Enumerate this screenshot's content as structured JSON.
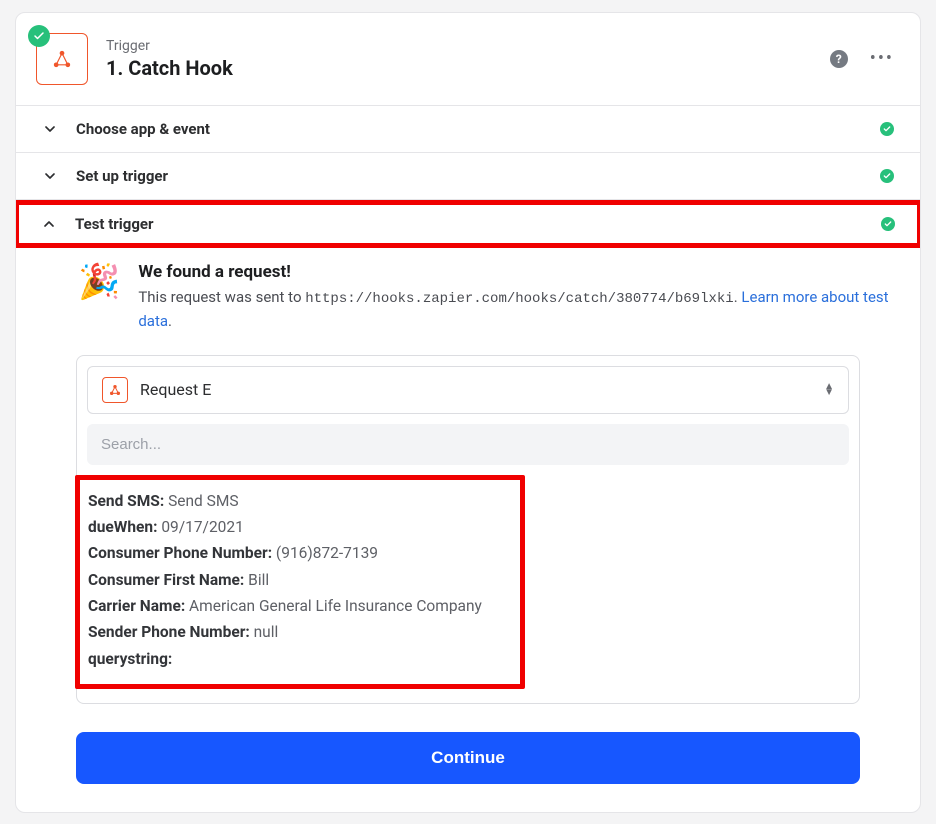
{
  "header": {
    "kicker": "Trigger",
    "title": "1. Catch Hook"
  },
  "rows": {
    "choose": "Choose app & event",
    "setup": "Set up trigger",
    "test": "Test trigger"
  },
  "found": {
    "title": "We found a request!",
    "lead": "This request was sent to ",
    "url": "https://hooks.zapier.com/hooks/catch/380774/b69lxki",
    "link_text": "Learn more about test data",
    "dot": "."
  },
  "dropdown": {
    "selected": "Request E"
  },
  "search": {
    "placeholder": "Search..."
  },
  "fields": [
    {
      "k": "Send SMS:",
      "v": "Send SMS"
    },
    {
      "k": "dueWhen:",
      "v": "09/17/2021"
    },
    {
      "k": "Consumer Phone Number:",
      "v": "(916)872-7139"
    },
    {
      "k": "Consumer First Name:",
      "v": "Bill"
    },
    {
      "k": "Carrier Name:",
      "v": "American General Life Insurance Company"
    },
    {
      "k": "Sender Phone Number:",
      "v": "null"
    },
    {
      "k": "querystring:",
      "v": ""
    }
  ],
  "footer": {
    "continue": "Continue"
  }
}
